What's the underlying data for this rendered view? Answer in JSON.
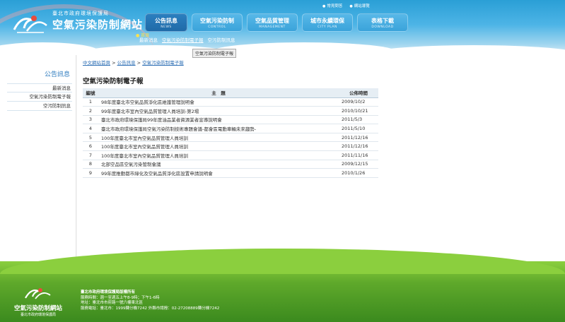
{
  "header": {
    "dept_name": "臺北市政府環境保護局",
    "site_name": "空氣污染防制網站",
    "home_link": "● 首頁",
    "top_links": [
      "常見問答",
      "網站導覽"
    ],
    "nav": [
      {
        "zh": "公告訊息",
        "en": "NEWS",
        "active": true
      },
      {
        "zh": "空氣污染防制",
        "en": "CONTROL",
        "active": false
      },
      {
        "zh": "空氣品質管理",
        "en": "MANAGEMENT",
        "active": false
      },
      {
        "zh": "城市永續環保",
        "en": "CITY PLAN",
        "active": false
      },
      {
        "zh": "表格下載",
        "en": "DOWNLOAD",
        "active": false
      }
    ],
    "sub_nav": [
      "最新消息",
      "空氣污染防制電子報",
      "空污防制訊息"
    ],
    "tooltip": "空氣污染防制電子報"
  },
  "sidebar": {
    "title": "公告訊息",
    "items": [
      "最新消息",
      "空氣污染防制電子報",
      "空污防制訊息"
    ]
  },
  "breadcrumb": {
    "home": "中文網站首頁",
    "sep": " > ",
    "section": "公告訊息",
    "current": "空氣污染防制電子報"
  },
  "page_title": "空氣污染防制電子報",
  "table": {
    "headers": [
      "編號",
      "主　題",
      "公佈時間"
    ],
    "rows": [
      {
        "no": "1",
        "title": "98年度臺北市空氣品質淨化區維護管理說明會",
        "date": "2009/10/2"
      },
      {
        "no": "2",
        "title": "99年度臺北市室內空氣品質管理人員培訓-第2場",
        "date": "2010/10/21"
      },
      {
        "no": "3",
        "title": "臺北市政府環境保護局99年度油品業者資源業者宣導說明會",
        "date": "2011/5/3"
      },
      {
        "no": "4",
        "title": "臺北市政府環境保護局空氣污染防制技術專題會議-都會區電動車輛未來趨勢-",
        "date": "2011/5/10"
      },
      {
        "no": "5",
        "title": "100年度臺北市室內空氣品質管理人員培訓",
        "date": "2011/12/16"
      },
      {
        "no": "6",
        "title": "100年度臺北市室內空氣品質管理人員培訓",
        "date": "2011/12/16"
      },
      {
        "no": "7",
        "title": "100年度臺北市室內空氣品質管理人員培訓",
        "date": "2011/11/16"
      },
      {
        "no": "8",
        "title": "北部空品區空氣污染管制會議",
        "date": "2009/12/15"
      },
      {
        "no": "9",
        "title": "99年度推動都市綠化及空氣品質淨化區設置申請說明會",
        "date": "2010/1/26"
      }
    ]
  },
  "footer": {
    "logo_name": "空氣污染防制網站",
    "logo_dept": "臺北市政府環境保護局",
    "org": "臺北市政府環境保護局版權所有",
    "hours": "服務時間：週一至週五上午8-9時；下午1-6時",
    "address": "地址：臺北市市府路一號六樓東北區",
    "phone": "服務電話：臺北市：1999轉分機7242 外縣市請撥：02-27208889轉分機7242"
  },
  "colors": {
    "header_blue": "#2a9fd6",
    "nav_active": "#1f6aa8",
    "link_blue": "#2e6fb5",
    "footer_green": "#5fa92b"
  }
}
